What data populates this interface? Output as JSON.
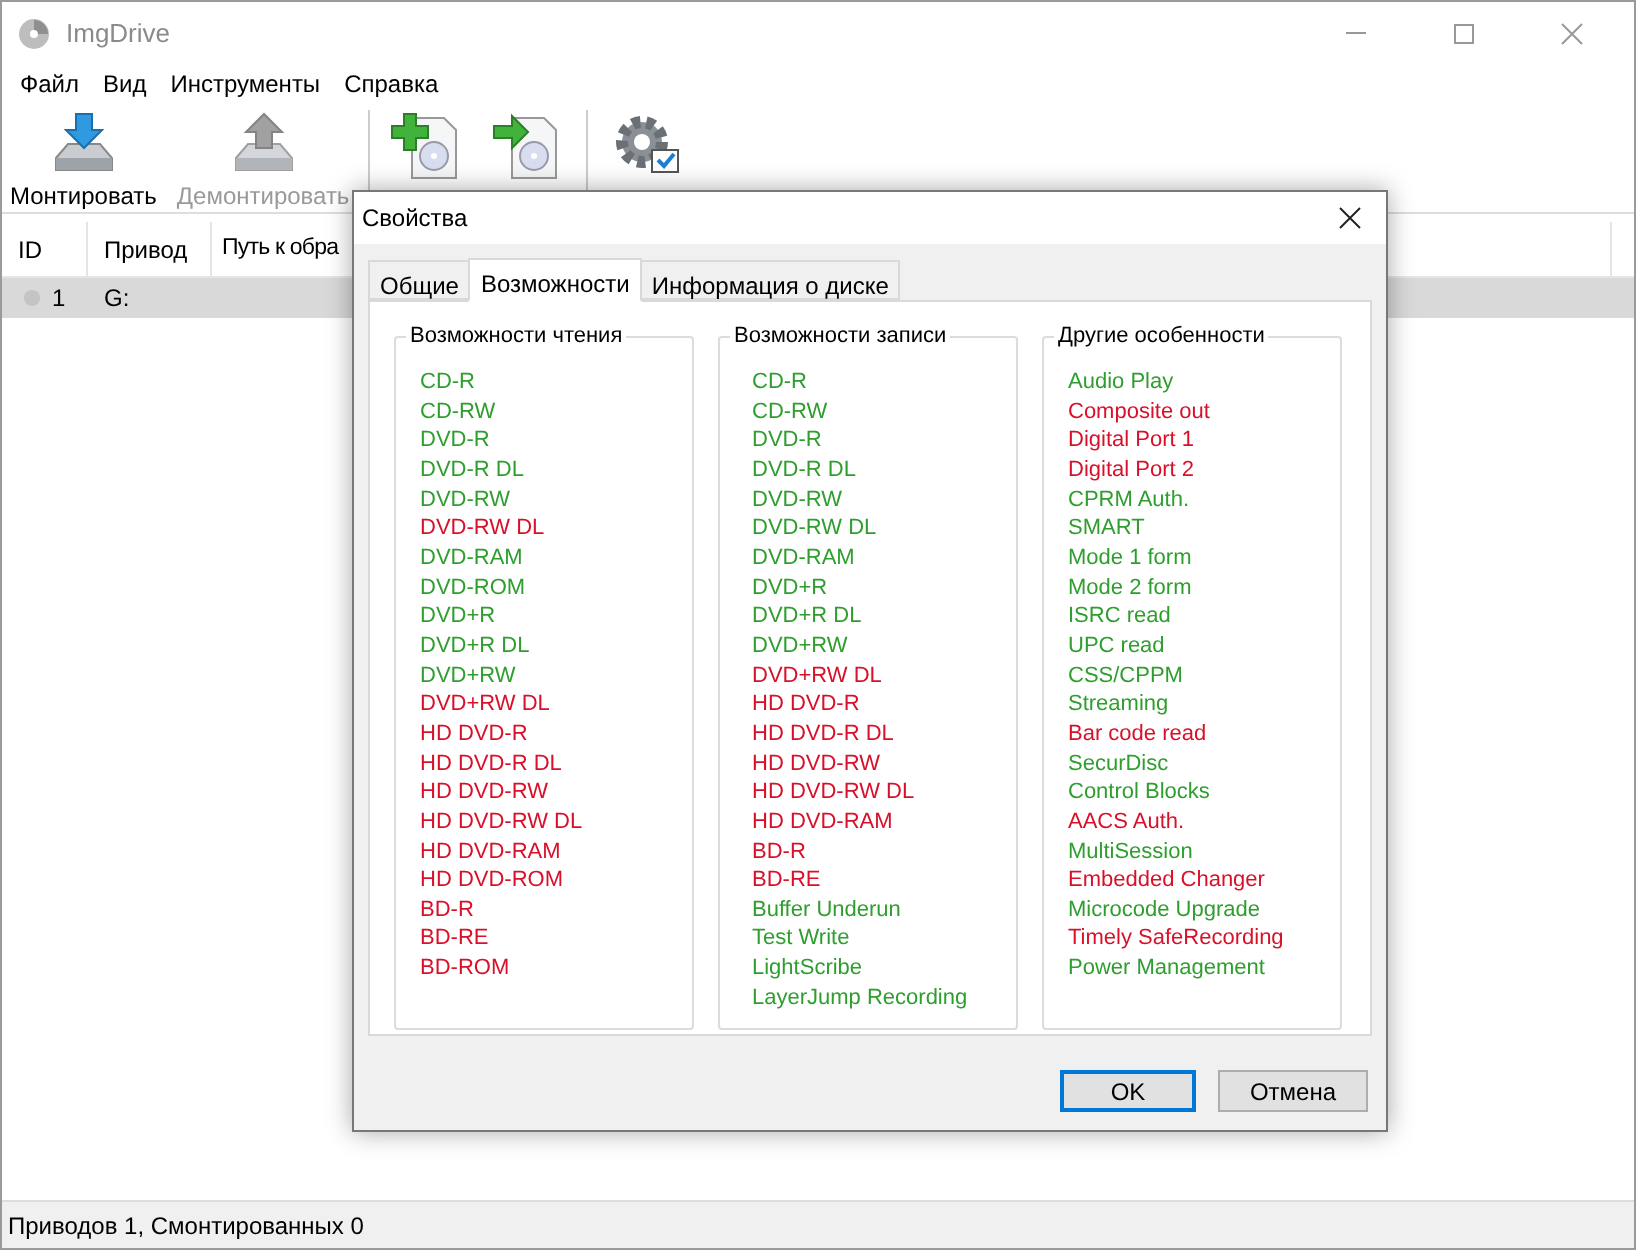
{
  "window": {
    "title": "ImgDrive"
  },
  "menu": [
    "Файл",
    "Вид",
    "Инструменты",
    "Справка"
  ],
  "toolbar": {
    "groups": [
      [
        {
          "kind": "mount",
          "label": "Монтировать",
          "disabled": false
        },
        {
          "kind": "unmount",
          "label": "Демонтировать",
          "disabled": true
        }
      ],
      [
        {
          "kind": "create",
          "disabled": false
        },
        {
          "kind": "copy",
          "disabled": false
        }
      ],
      [
        {
          "kind": "settings",
          "disabled": false
        }
      ]
    ]
  },
  "table": {
    "columns": [
      "ID",
      "Привод",
      "Путь к обра"
    ],
    "rows": [
      {
        "cells": [
          "1",
          "G:"
        ],
        "selected": true
      }
    ]
  },
  "status_bar": "Приводов 1, Смонтированных 0",
  "dialog": {
    "title": "Свойства",
    "tabs": [
      {
        "label": "Общие",
        "selected": false
      },
      {
        "label": "Возможности",
        "selected": true
      },
      {
        "label": "Информация о диске",
        "selected": false
      }
    ],
    "groups": [
      {
        "title": "Возможности чтения",
        "items": [
          {
            "label": "CD-R",
            "supported": true
          },
          {
            "label": "CD-RW",
            "supported": true
          },
          {
            "label": "DVD-R",
            "supported": true
          },
          {
            "label": "DVD-R DL",
            "supported": true
          },
          {
            "label": "DVD-RW",
            "supported": true
          },
          {
            "label": "DVD-RW DL",
            "supported": false
          },
          {
            "label": "DVD-RAM",
            "supported": true
          },
          {
            "label": "DVD-ROM",
            "supported": true
          },
          {
            "label": "DVD+R",
            "supported": true
          },
          {
            "label": "DVD+R DL",
            "supported": true
          },
          {
            "label": "DVD+RW",
            "supported": true
          },
          {
            "label": "DVD+RW DL",
            "supported": false
          },
          {
            "label": "HD DVD-R",
            "supported": false
          },
          {
            "label": "HD DVD-R DL",
            "supported": false
          },
          {
            "label": "HD DVD-RW",
            "supported": false
          },
          {
            "label": "HD DVD-RW DL",
            "supported": false
          },
          {
            "label": "HD DVD-RAM",
            "supported": false
          },
          {
            "label": "HD DVD-ROM",
            "supported": false
          },
          {
            "label": "BD-R",
            "supported": false
          },
          {
            "label": "BD-RE",
            "supported": false
          },
          {
            "label": "BD-ROM",
            "supported": false
          }
        ]
      },
      {
        "title": "Возможности записи",
        "items": [
          {
            "label": "CD-R",
            "supported": true
          },
          {
            "label": "CD-RW",
            "supported": true
          },
          {
            "label": "DVD-R",
            "supported": true
          },
          {
            "label": "DVD-R DL",
            "supported": true
          },
          {
            "label": "DVD-RW",
            "supported": true
          },
          {
            "label": "DVD-RW DL",
            "supported": true
          },
          {
            "label": "DVD-RAM",
            "supported": true
          },
          {
            "label": "DVD+R",
            "supported": true
          },
          {
            "label": "DVD+R DL",
            "supported": true
          },
          {
            "label": "DVD+RW",
            "supported": true
          },
          {
            "label": "DVD+RW DL",
            "supported": false
          },
          {
            "label": "HD DVD-R",
            "supported": false
          },
          {
            "label": "HD DVD-R DL",
            "supported": false
          },
          {
            "label": "HD DVD-RW",
            "supported": false
          },
          {
            "label": "HD DVD-RW DL",
            "supported": false
          },
          {
            "label": "HD DVD-RAM",
            "supported": false
          },
          {
            "label": "BD-R",
            "supported": false
          },
          {
            "label": "BD-RE",
            "supported": false
          },
          {
            "label": "Buffer Underun",
            "supported": true
          },
          {
            "label": "Test Write",
            "supported": true
          },
          {
            "label": "LightScribe",
            "supported": true
          },
          {
            "label": "LayerJump Recording",
            "supported": true
          }
        ]
      },
      {
        "title": "Другие особенности",
        "items": [
          {
            "label": "Audio Play",
            "supported": true
          },
          {
            "label": "Composite out",
            "supported": false
          },
          {
            "label": "Digital Port 1",
            "supported": false
          },
          {
            "label": "Digital Port 2",
            "supported": false
          },
          {
            "label": "CPRM Auth.",
            "supported": true
          },
          {
            "label": "SMART",
            "supported": true
          },
          {
            "label": "Mode 1 form",
            "supported": true
          },
          {
            "label": "Mode 2 form",
            "supported": true
          },
          {
            "label": "ISRC read",
            "supported": true
          },
          {
            "label": "UPC read",
            "supported": true
          },
          {
            "label": "CSS/CPPM",
            "supported": true
          },
          {
            "label": "Streaming",
            "supported": true
          },
          {
            "label": "Bar code read",
            "supported": false
          },
          {
            "label": "SecurDisc",
            "supported": true
          },
          {
            "label": "Control Blocks",
            "supported": true
          },
          {
            "label": "AACS Auth.",
            "supported": false
          },
          {
            "label": "MultiSession",
            "supported": true
          },
          {
            "label": "Embedded Changer",
            "supported": false
          },
          {
            "label": "Microcode Upgrade",
            "supported": true
          },
          {
            "label": "Timely SafeRecording",
            "supported": false
          },
          {
            "label": "Power Management",
            "supported": true
          }
        ]
      }
    ],
    "buttons": [
      {
        "label": "OK",
        "default": true
      },
      {
        "label": "Отмена",
        "default": false
      }
    ]
  }
}
